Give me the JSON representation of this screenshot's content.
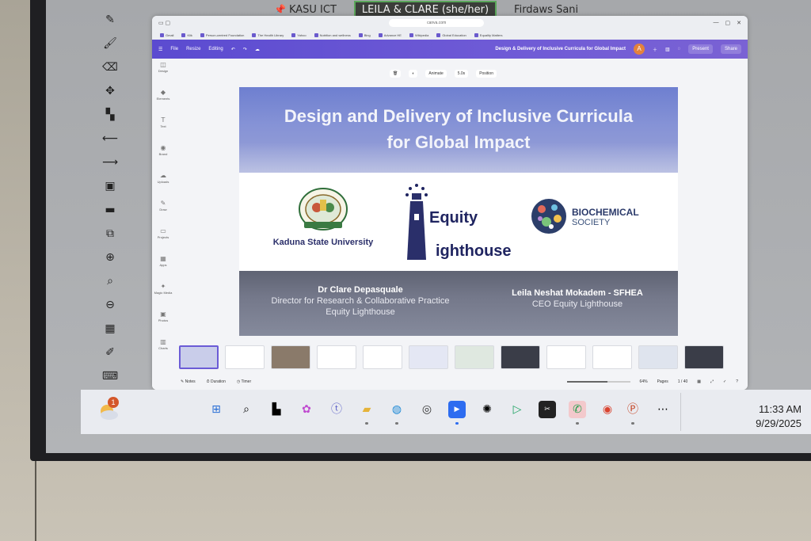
{
  "meeting": {
    "participants": [
      {
        "name": "KASU ICT",
        "pinned": true,
        "active": false
      },
      {
        "name": "LEILA & CLARE (she/her)",
        "pinned": false,
        "active": true
      },
      {
        "name": "Firdaws Sani",
        "pinned": false,
        "active": false
      }
    ]
  },
  "annotation_tools": [
    "pen-icon",
    "highlighter-icon",
    "eraser-icon",
    "move-icon",
    "select-icon",
    "undo-icon",
    "redo-icon",
    "save-icon",
    "folder-icon",
    "screen-icon",
    "zoom-in-icon",
    "zoom-icon",
    "zoom-out-icon",
    "grid-icon",
    "edit-icon",
    "keyboard-icon"
  ],
  "browser": {
    "url": "canva.com",
    "bookmarks": [
      "Gmail",
      "Klik",
      "Person-centred Foundation",
      "The Health Library",
      "Yahoo",
      "Nutrition and wellness",
      "Bing",
      "Advance HE",
      "Wikipedia",
      "Global Education",
      "Equality Matters"
    ]
  },
  "canva": {
    "menu": {
      "file": "File",
      "resize": "Resize",
      "editing": "Editing"
    },
    "doc_title": "Design & Delivery of Inclusive Curricula for Global Impact",
    "avatar": "A",
    "present": "Present",
    "share": "Share",
    "rail": [
      "Design",
      "Elements",
      "Text",
      "Brand",
      "Uploads",
      "Draw",
      "Projects",
      "Apps",
      "Magic Media",
      "Photos",
      "Charts"
    ],
    "canvas_tools": {
      "animate": "Animate",
      "duration": "5.0s",
      "position": "Position"
    },
    "status": {
      "notes": "Notes",
      "duration": "Duration",
      "timer": "Timer",
      "zoom": "64%",
      "pages": "Pages",
      "page_count": "1 / 40"
    }
  },
  "slide": {
    "title_line1": "Design and Delivery of Inclusive Curricula",
    "title_line2": "for Global Impact",
    "logo_ksu": "Kaduna State University",
    "logo_equity_a": "Equity",
    "logo_equity_b": "ighthouse",
    "logo_bio_a": "BIOCHEMICAL",
    "logo_bio_b": "SOCIETY",
    "presenter1_name": "Dr Clare Depasquale",
    "presenter1_role1": "Director for Research & Collaborative Practice",
    "presenter1_role2": "Equity Lighthouse",
    "presenter2_name": "Leila Neshat Mokadem - SFHEA",
    "presenter2_role": "CEO Equity Lighthouse"
  },
  "thumbnails": {
    "count_visible": 12,
    "active_index": 0,
    "zoom_fraction": 0.64
  },
  "taskbar": {
    "weather_badge": "1",
    "apps": [
      "windows-icon",
      "search-icon",
      "task-view-icon",
      "copilot-icon",
      "teams-icon",
      "file-explorer-icon",
      "edge-icon",
      "camera-icon",
      "zoom-icon",
      "chatgpt-icon",
      "play-store-icon",
      "capcut-icon",
      "whatsapp-icon",
      "chrome-icon",
      "powerpoint-icon",
      "more-icon"
    ],
    "time": "11:33 AM",
    "date": "9/29/2025"
  }
}
